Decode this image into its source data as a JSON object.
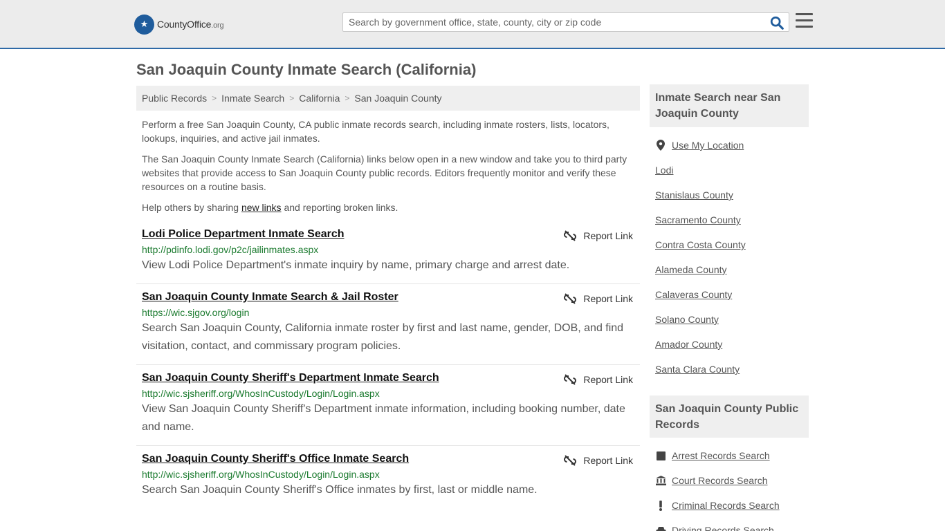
{
  "header": {
    "logo_main": "CountyOffice",
    "logo_tld": ".org",
    "search_placeholder": "Search by government office, state, county, city or zip code"
  },
  "page": {
    "title": "San Joaquin County Inmate Search (California)"
  },
  "breadcrumb": [
    "Public Records",
    "Inmate Search",
    "California",
    "San Joaquin County"
  ],
  "intro": {
    "p1": "Perform a free San Joaquin County, CA public inmate records search, including inmate rosters, lists, locators, lookups, inquiries, and active jail inmates.",
    "p2": "The San Joaquin County Inmate Search (California) links below open in a new window and take you to third party websites that provide access to San Joaquin County public records. Editors frequently monitor and verify these resources on a routine basis.",
    "p3_before": "Help others by sharing",
    "p3_link": "new links",
    "p3_after": "and reporting broken links."
  },
  "report_label": "Report Link",
  "results": [
    {
      "title": "Lodi Police Department Inmate Search",
      "url": "http://pdinfo.lodi.gov/p2c/jailinmates.aspx",
      "desc": "View Lodi Police Department's inmate inquiry by name, primary charge and arrest date."
    },
    {
      "title": "San Joaquin County Inmate Search & Jail Roster",
      "url": "https://wic.sjgov.org/login",
      "desc": "Search San Joaquin County, California inmate roster by first and last name, gender, DOB, and find visitation, contact, and commissary program policies."
    },
    {
      "title": "San Joaquin County Sheriff's Department Inmate Search",
      "url": "http://wic.sjsheriff.org/WhosInCustody/Login/Login.aspx",
      "desc": "View San Joaquin County Sheriff's Department inmate information, including booking number, date and name."
    },
    {
      "title": "San Joaquin County Sheriff's Office Inmate Search",
      "url": "http://wic.sjsheriff.org/WhosInCustody/Login/Login.aspx",
      "desc": "Search San Joaquin County Sheriff's Office inmates by first, last or middle name."
    }
  ],
  "sidebar": {
    "nearby_title": "Inmate Search near San Joaquin County",
    "nearby_items": [
      {
        "label": "Use My Location",
        "icon": "map-marker-icon"
      },
      {
        "label": "Lodi"
      },
      {
        "label": "Stanislaus County"
      },
      {
        "label": "Sacramento County"
      },
      {
        "label": "Contra Costa County"
      },
      {
        "label": "Alameda County"
      },
      {
        "label": "Calaveras County"
      },
      {
        "label": "Solano County"
      },
      {
        "label": "Amador County"
      },
      {
        "label": "Santa Clara County"
      }
    ],
    "records_title": "San Joaquin County Public Records",
    "records_items": [
      {
        "label": "Arrest Records Search",
        "icon": "square-icon"
      },
      {
        "label": "Court Records Search",
        "icon": "courthouse-icon"
      },
      {
        "label": "Criminal Records Search",
        "icon": "exclamation-icon"
      },
      {
        "label": "Driving Records Search",
        "icon": "car-icon"
      }
    ]
  },
  "colors": {
    "header_bg": "#ececec",
    "header_border": "#2f6aa7",
    "url_green": "#1a7a2e",
    "logo_blue": "#1f5c9c",
    "search_icon_blue": "#1f5c9c"
  }
}
